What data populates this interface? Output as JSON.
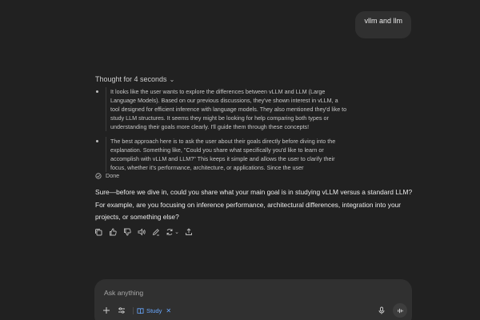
{
  "user_message": "vllm and llm",
  "thinking": {
    "header": "Thought for 4 seconds",
    "items": [
      "It looks like the user wants to explore the differences between vLLM and LLM (Large Language Models). Based on our previous discussions, they've shown interest in vLLM, a tool designed for efficient inference with language models. They also mentioned they'd like to study LLM structures. It seems they might be looking for help comparing both types or understanding their goals more clearly. I'll guide them through these concepts!",
      "The best approach here is to ask the user about their goals directly before diving into the explanation. Something like, \"Could you share what specifically you'd like to learn or accomplish with vLLM and LLM?\" This keeps it simple and allows the user to clarify their focus, whether it's performance, architecture, or applications. Since the user"
    ],
    "done_label": "Done"
  },
  "assistant_answer": "Sure—before we dive in, could you share what your main goal is in studying vLLM versus a standard LLM? For example, are you focusing on inference performance, architectural differences, integration into your projects, or something else?",
  "action_icons": [
    "copy-icon",
    "thumbs-up-icon",
    "thumbs-down-icon",
    "speaker-icon",
    "edit-icon",
    "regenerate-icon",
    "share-icon"
  ],
  "composer": {
    "placeholder": "Ask anything",
    "study_chip": "Study",
    "icons": [
      "plus-icon",
      "tools-icon",
      "book-icon",
      "close-icon",
      "mic-icon",
      "voice-mode-icon"
    ]
  },
  "colors": {
    "background": "#212121",
    "bubble": "#303030",
    "accent": "#69a8ff"
  }
}
